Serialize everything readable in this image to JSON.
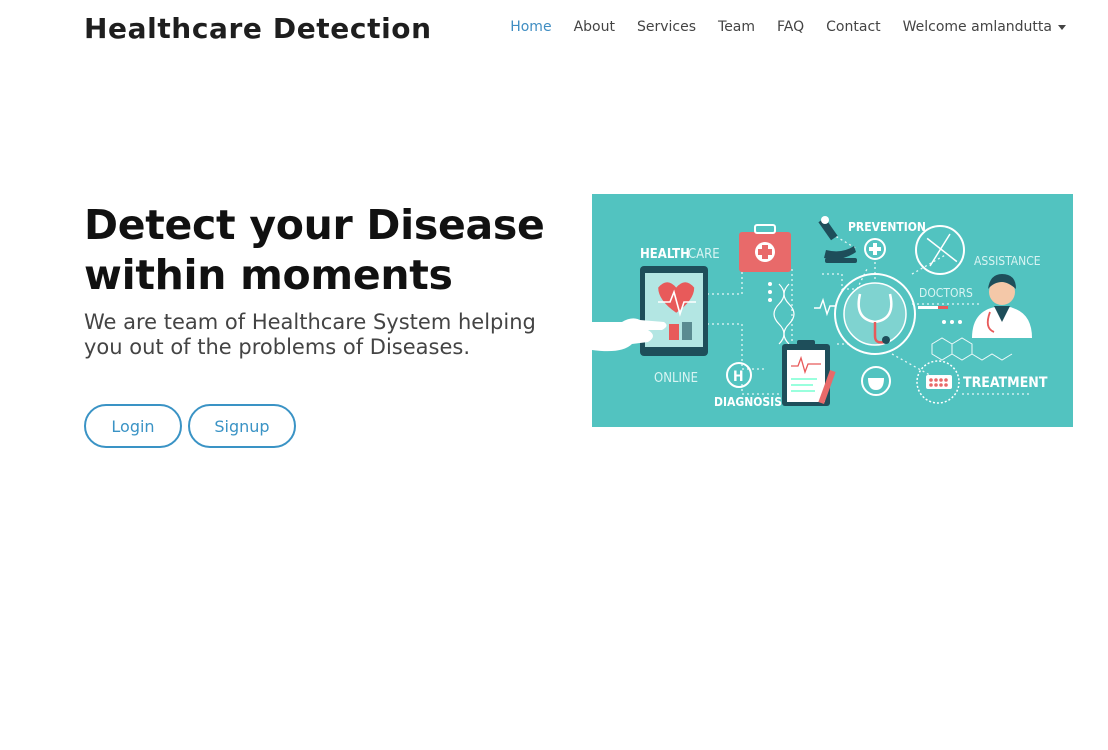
{
  "header": {
    "brand": "Healthcare Detection",
    "nav": [
      {
        "label": "Home",
        "active": true
      },
      {
        "label": "About"
      },
      {
        "label": "Services"
      },
      {
        "label": "Team"
      },
      {
        "label": "FAQ"
      },
      {
        "label": "Contact"
      }
    ],
    "user_menu": "Welcome amlandutta"
  },
  "hero": {
    "headline_line1": "Detect your Disease",
    "headline_line2": "within moments",
    "subtitle": "We are team of Healthcare System helping you out of the problems of Diseases.",
    "login_label": "Login",
    "signup_label": "Signup"
  },
  "illustration": {
    "background": "#52c3c0",
    "labels": {
      "healthcare_bold": "HEALTH",
      "healthcare_light": "CARE",
      "prevention": "PREVENTION",
      "assistance": "ASSISTANCE",
      "doctors": "DOCTORS",
      "online": "ONLINE",
      "diagnosis": "DIAGNOSIS",
      "treatment": "TREATMENT"
    }
  },
  "colors": {
    "accent": "#3a93c5",
    "nav_active": "#3f8dc2",
    "illustration_bg": "#52c3c0"
  }
}
